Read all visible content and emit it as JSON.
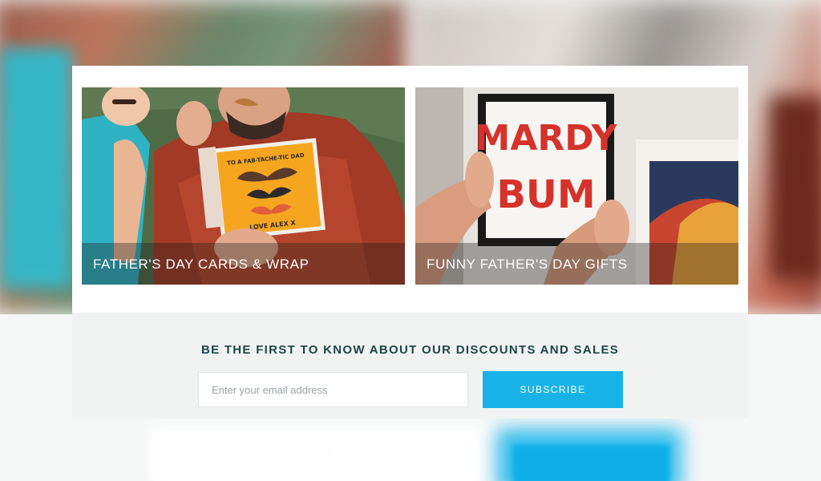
{
  "cards": [
    {
      "caption": "FATHER'S DAY CARDS & WRAP",
      "image": "father-and-child-with-greeting-card-photo"
    },
    {
      "caption": "FUNNY FATHER'S DAY GIFTS",
      "image": "framed-print-being-hung-photo"
    }
  ],
  "card_artwork": {
    "greeting_card_top": "TO A FAB-TACHE-TIC DAD",
    "greeting_card_bottom": "LOVE ALEX X",
    "print_line1": "MARDY",
    "print_line2": "BUM"
  },
  "signup": {
    "title": "BE THE FIRST TO KNOW ABOUT OUR DISCOUNTS AND SALES",
    "email_placeholder": "Enter your email address",
    "email_value": "",
    "subscribe_label": "SUBSCRIBE"
  },
  "colors": {
    "accent": "#18b3e6",
    "title_text": "#1d4548",
    "footer_bg": "#f1f3f3"
  }
}
